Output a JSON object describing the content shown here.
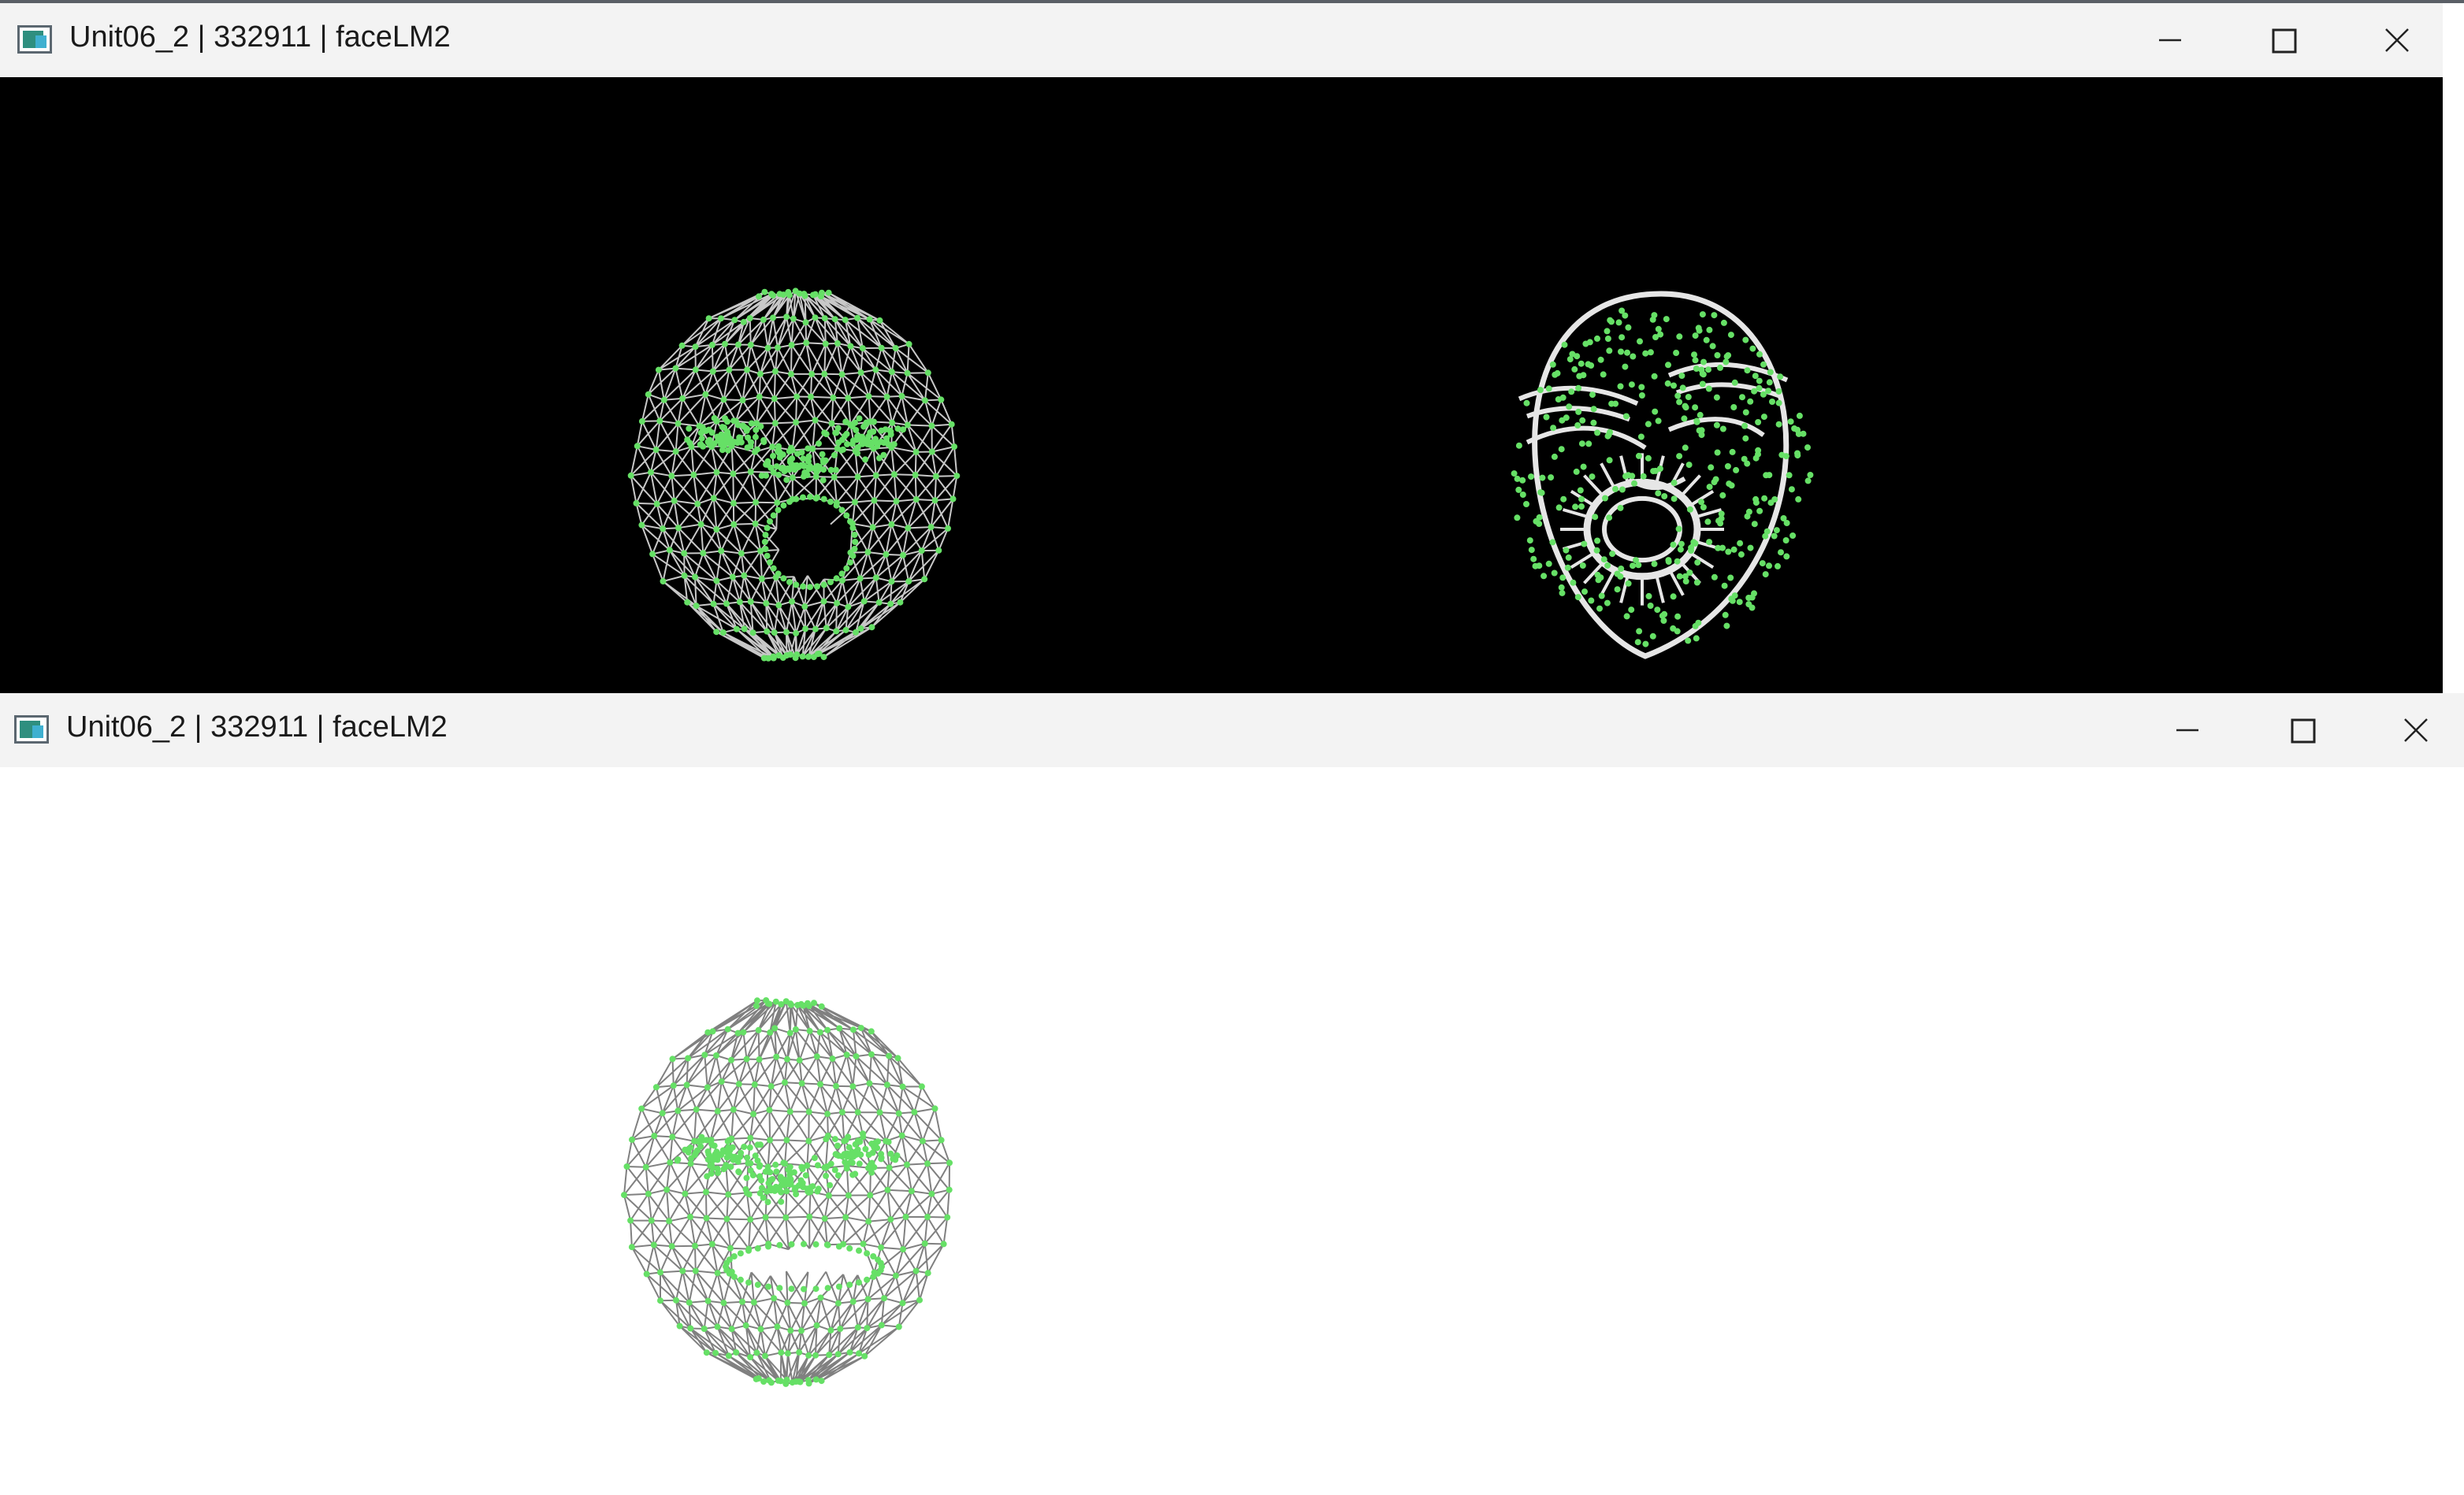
{
  "windows": [
    {
      "title": "Unit06_2 | 332911 | faceLM2",
      "icon": "app-window-icon",
      "controls": [
        "minimize",
        "maximize",
        "close"
      ],
      "canvas_background": "#000000",
      "faces": [
        "wireframe-mesh-face",
        "contour-landmark-face"
      ]
    },
    {
      "title": "Unit06_2 | 332911 | faceLM2",
      "icon": "app-window-icon",
      "controls": [
        "minimize",
        "maximize",
        "close"
      ],
      "canvas_background": "#ffffff",
      "faces": [
        "wireframe-mesh-face"
      ]
    }
  ],
  "colors": {
    "landmark_point": "#66e066",
    "mesh_line_dark_bg": "#c8c8c8",
    "mesh_line_light_bg": "#808080",
    "contour_line": "#e6e6e6"
  }
}
